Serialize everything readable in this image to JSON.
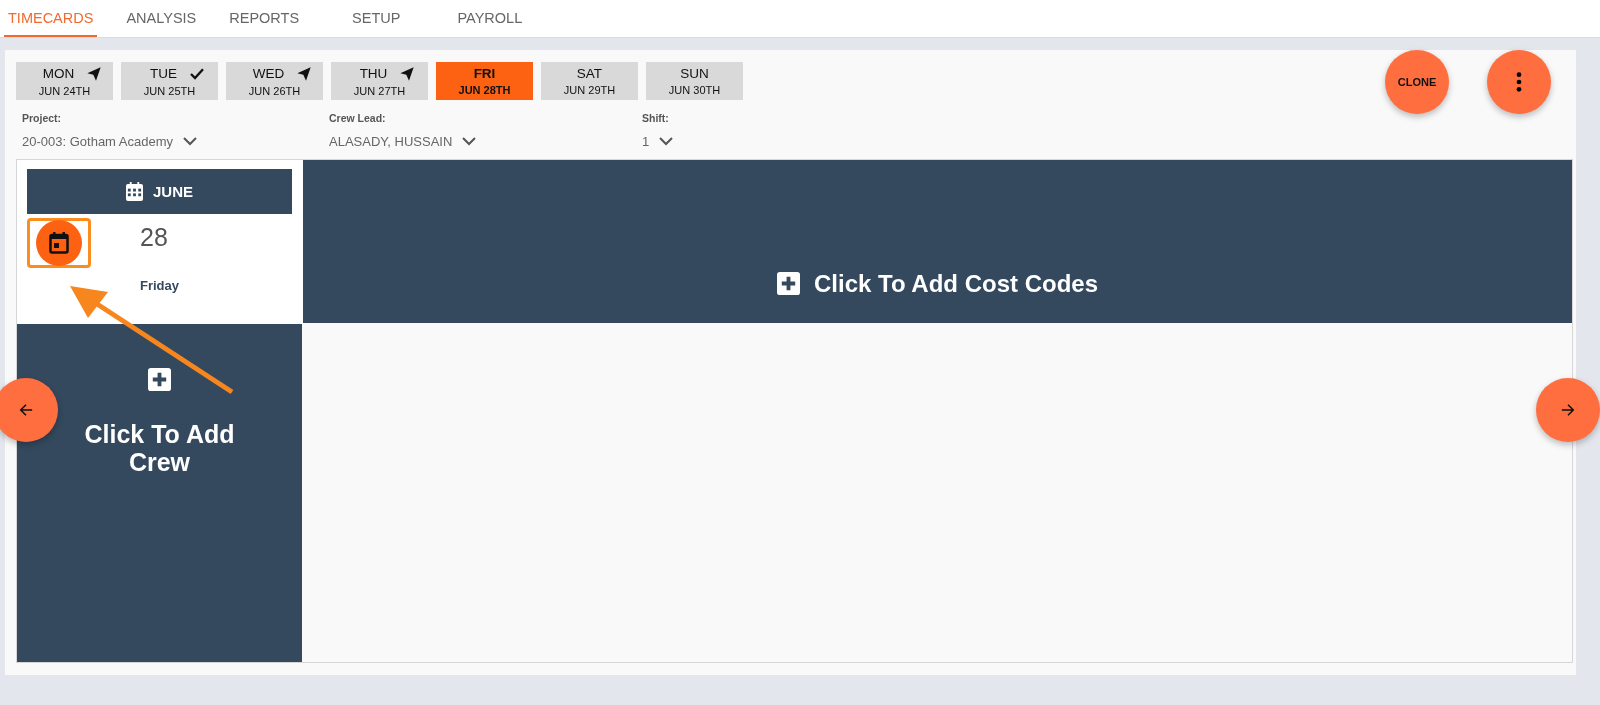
{
  "nav_tabs": [
    {
      "label": "TIMECARDS",
      "selected": true
    },
    {
      "label": "ANALYSIS",
      "selected": false
    },
    {
      "label": "REPORTS",
      "selected": false
    },
    {
      "label": "SETUP",
      "selected": false
    },
    {
      "label": "PAYROLL",
      "selected": false
    }
  ],
  "days": [
    {
      "day": "MON",
      "date": "JUN 24TH",
      "kind": "sent",
      "selected": false
    },
    {
      "day": "TUE",
      "date": "JUN 25TH",
      "kind": "approved",
      "selected": false
    },
    {
      "day": "WED",
      "date": "JUN 26TH",
      "kind": "sent",
      "selected": false
    },
    {
      "day": "THU",
      "date": "JUN 27TH",
      "kind": "sent",
      "selected": false
    },
    {
      "day": "FRI",
      "date": "JUN 28TH",
      "kind": "plain",
      "selected": true
    },
    {
      "day": "SAT",
      "date": "JUN 29TH",
      "kind": "plain",
      "selected": false
    },
    {
      "day": "SUN",
      "date": "JUN 30TH",
      "kind": "plain",
      "selected": false
    }
  ],
  "clone_button": "CLONE",
  "filters": [
    {
      "label": "Project:",
      "value": "20-003: Gotham Academy"
    },
    {
      "label": "Crew Lead:",
      "value": "ALASADY, HUSSAIN"
    },
    {
      "label": "Shift:",
      "value": "1"
    }
  ],
  "calendar": {
    "month": "JUNE",
    "day": "28",
    "weekday": "Friday"
  },
  "add_cost_codes": "Click To Add Cost Codes",
  "add_crew": "Click To Add Crew"
}
